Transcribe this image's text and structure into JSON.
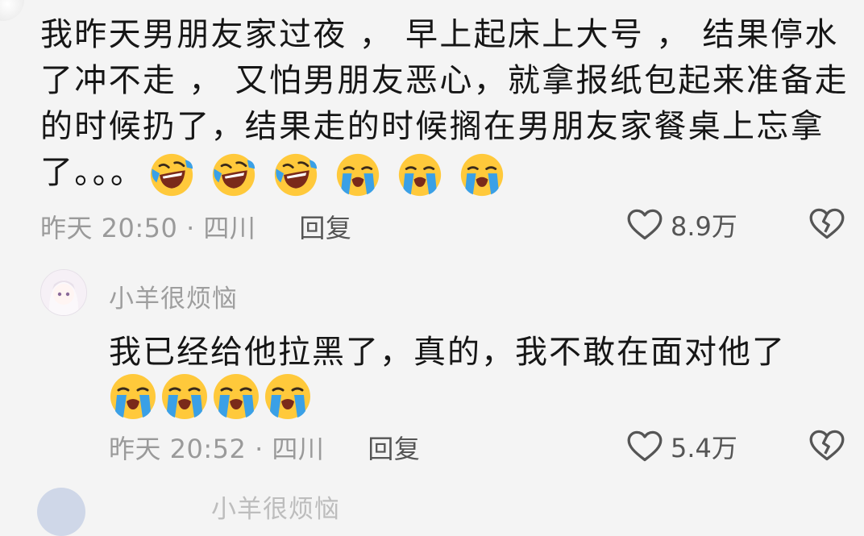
{
  "comment1": {
    "text": "我昨天男朋友家过夜 ， 早上起床上大号 ， 结果停水了冲不走 ， 又怕男朋友恶心，就拿报纸包起来准备走的时候扔了，结果走的时候搁在男朋友家餐桌上忘拿了。。。",
    "emojis": [
      "laugh-cry-face",
      "laugh-cry-face",
      "laugh-cry-face",
      "loudly-crying-face",
      "loudly-crying-face",
      "loudly-crying-face"
    ],
    "meta": "昨天 20:50 · 四川",
    "reply_label": "回复",
    "likes": "8.9万"
  },
  "reply1": {
    "author": "小羊很烦恼",
    "text": "我已经给他拉黑了，真的，我不敢在面对他了",
    "emojis": [
      "loudly-crying-face",
      "loudly-crying-face",
      "loudly-crying-face",
      "loudly-crying-face"
    ],
    "meta": "昨天 20:52 · 四川",
    "reply_label": "回复",
    "likes": "5.4万"
  },
  "reply2": {
    "author": "小羊很烦恼"
  },
  "colors": {
    "background": "#f4f4f4",
    "text": "#161616",
    "meta": "#9a9a9a",
    "emoji_face": "#ffc93b",
    "tears": "#3aa0e6"
  }
}
